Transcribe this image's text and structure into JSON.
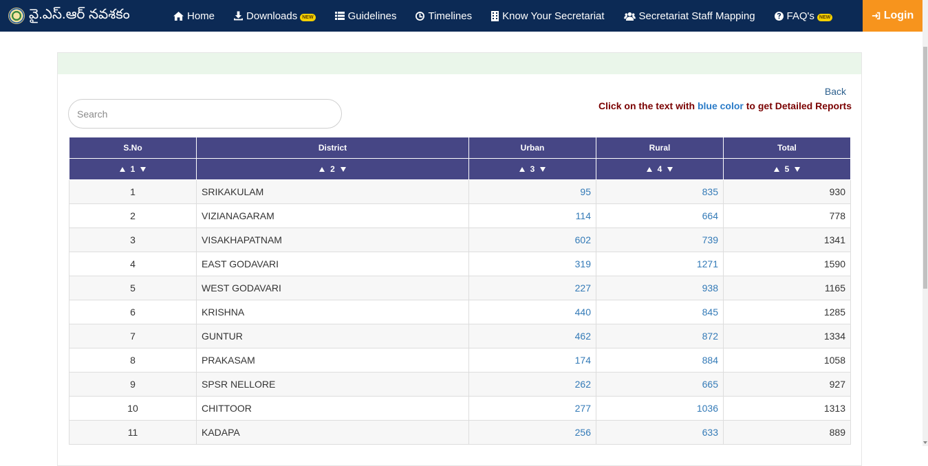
{
  "navbar": {
    "brand": "వై.ఎస్.ఆర్ నవశకం",
    "items": [
      {
        "label": "Home",
        "icon": "home-icon",
        "new": false
      },
      {
        "label": "Downloads",
        "icon": "download-icon",
        "new": true
      },
      {
        "label": "Guidelines",
        "icon": "list-icon",
        "new": false
      },
      {
        "label": "Timelines",
        "icon": "clock-icon",
        "new": false
      },
      {
        "label": "Know Your Secretariat",
        "icon": "building-icon",
        "new": false
      },
      {
        "label": "Secretariat Staff Mapping",
        "icon": "users-icon",
        "new": false
      },
      {
        "label": "FAQ's",
        "icon": "question-circle-icon",
        "new": true
      }
    ],
    "new_badge": "NEW",
    "login": "Login",
    "colors": {
      "bar": "#0c2a55",
      "login": "#f7941d"
    }
  },
  "panel": {
    "back": "Back",
    "hint": {
      "before": "Click on the text with ",
      "blue": "blue color",
      "after": " to get Detailed Reports"
    },
    "search_placeholder": "Search"
  },
  "table": {
    "header_color": "#464685",
    "link_color": "#337ab7",
    "headers": [
      "S.No",
      "District",
      "Urban",
      "Rural",
      "Total"
    ],
    "sort_numbers": [
      "1",
      "2",
      "3",
      "4",
      "5"
    ],
    "rows": [
      {
        "sno": "1",
        "district": "SRIKAKULAM",
        "urban": "95",
        "rural": "835",
        "total": "930"
      },
      {
        "sno": "2",
        "district": "VIZIANAGARAM",
        "urban": "114",
        "rural": "664",
        "total": "778"
      },
      {
        "sno": "3",
        "district": "VISAKHAPATNAM",
        "urban": "602",
        "rural": "739",
        "total": "1341"
      },
      {
        "sno": "4",
        "district": "EAST GODAVARI",
        "urban": "319",
        "rural": "1271",
        "total": "1590"
      },
      {
        "sno": "5",
        "district": "WEST GODAVARI",
        "urban": "227",
        "rural": "938",
        "total": "1165"
      },
      {
        "sno": "6",
        "district": "KRISHNA",
        "urban": "440",
        "rural": "845",
        "total": "1285"
      },
      {
        "sno": "7",
        "district": "GUNTUR",
        "urban": "462",
        "rural": "872",
        "total": "1334"
      },
      {
        "sno": "8",
        "district": "PRAKASAM",
        "urban": "174",
        "rural": "884",
        "total": "1058"
      },
      {
        "sno": "9",
        "district": "SPSR NELLORE",
        "urban": "262",
        "rural": "665",
        "total": "927"
      },
      {
        "sno": "10",
        "district": "CHITTOOR",
        "urban": "277",
        "rural": "1036",
        "total": "1313"
      },
      {
        "sno": "11",
        "district": "KADAPA",
        "urban": "256",
        "rural": "633",
        "total": "889"
      }
    ]
  }
}
